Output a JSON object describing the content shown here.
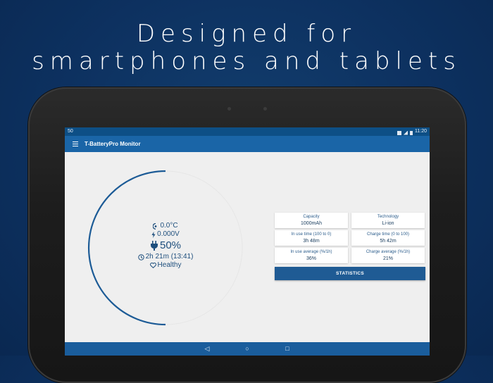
{
  "promo": {
    "line1": "Designed for",
    "line2": "smartphones and tablets"
  },
  "statusbar": {
    "left": "50",
    "time": "11:20",
    "icons": [
      "cast-icon",
      "signal-icon",
      "battery-icon"
    ]
  },
  "appbar": {
    "menu_icon": "hamburger-menu-icon",
    "title": "T-BatteryPro Monitor"
  },
  "gauge": {
    "level_percent": 50,
    "temperature": "0.0°C",
    "voltage": "0.000V",
    "level": "50%",
    "time_left": "2h 21m (13:41)",
    "health": "Healthy",
    "colors": {
      "arc": "#1c5b96",
      "track": "#e9e9e9",
      "text": "#1e4f7d"
    }
  },
  "cards": [
    {
      "label": "Capacity",
      "value": "1000mAh"
    },
    {
      "label": "Technology",
      "value": "Li-ion"
    },
    {
      "label": "In use time (100 to 0)",
      "value": "3h 48m"
    },
    {
      "label": "Charge time (0 to 100)",
      "value": "5h 42m"
    },
    {
      "label": "In use average (%/1h)",
      "value": "36%"
    },
    {
      "label": "Charge average (%/1h)",
      "value": "21%"
    }
  ],
  "statistics_button": "STATISTICS",
  "navbar": {
    "back": "◁",
    "home": "○",
    "recents": "□"
  }
}
